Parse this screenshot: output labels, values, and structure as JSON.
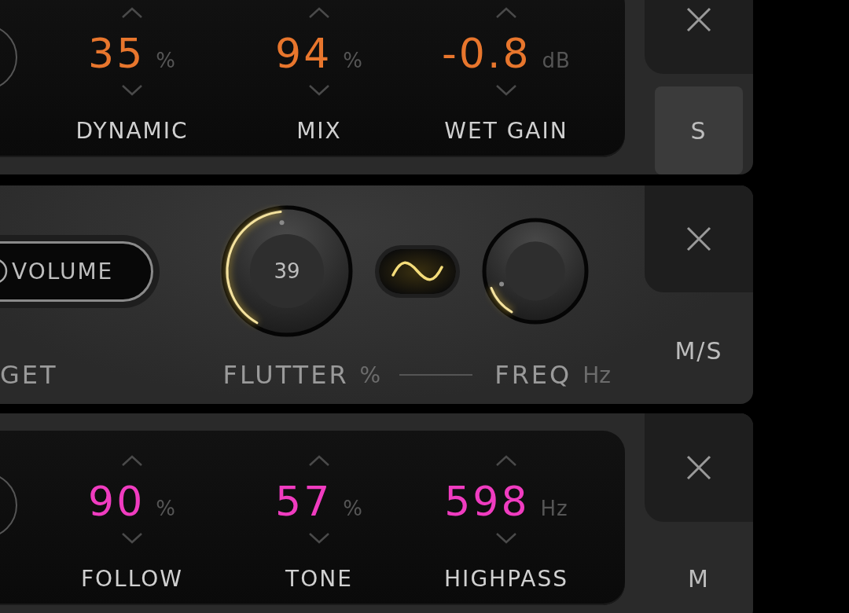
{
  "modules": [
    {
      "kind": "readouts",
      "color": "#e8762d",
      "params": [
        {
          "value": "35",
          "unit": "%",
          "label": "DYNAMIC"
        },
        {
          "value": "94",
          "unit": "%",
          "label": "MIX"
        },
        {
          "value": "-0.8",
          "unit": "dB",
          "label": "WET GAIN"
        }
      ],
      "side_button": {
        "label": "S",
        "selected": true
      }
    },
    {
      "kind": "flutter",
      "target_button": "VOLUME",
      "target_label": "GET",
      "flutter_knob": {
        "value": "39",
        "label": "FLUTTER",
        "unit": "%"
      },
      "wave_button": {
        "on": true
      },
      "freq_knob": {
        "label": "FREQ",
        "unit": "Hz"
      },
      "side_button": {
        "label": "M/S",
        "selected": false
      }
    },
    {
      "kind": "readouts",
      "color": "#f03cc0",
      "params": [
        {
          "value": "90",
          "unit": "%",
          "label": "FOLLOW"
        },
        {
          "value": "57",
          "unit": "%",
          "label": "TONE"
        },
        {
          "value": "598",
          "unit": "Hz",
          "label": "HIGHPASS"
        }
      ],
      "side_button": {
        "label": "M",
        "selected": false
      }
    }
  ]
}
